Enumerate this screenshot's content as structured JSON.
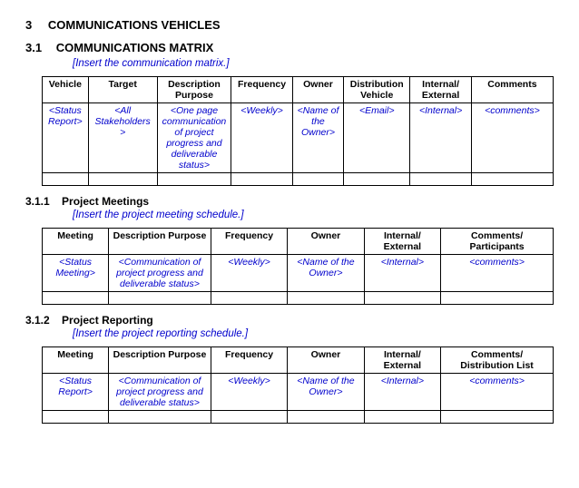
{
  "headings": {
    "h1_num": "3",
    "h1_text": "COMMUNICATIONS VEHICLES",
    "h2_num": "3.1",
    "h2_text": "COMMUNICATIONS MATRIX",
    "h2_instruction": "[Insert the communication matrix.]",
    "h3a_num": "3.1.1",
    "h3a_text": "Project Meetings",
    "h3a_instruction": "[Insert the project meeting schedule.]",
    "h3b_num": "3.1.2",
    "h3b_text": "Project Reporting",
    "h3b_instruction": "[Insert the project reporting schedule.]"
  },
  "table_matrix": {
    "headers": [
      "Vehicle",
      "Target",
      "Description Purpose",
      "Frequency",
      "Owner",
      "Distribution Vehicle",
      "Internal/ External",
      "Comments"
    ],
    "row": [
      "<Status Report>",
      "<All Stakeholders>",
      "<One page communication of project progress and deliverable status>",
      "<Weekly>",
      "<Name of the Owner>",
      "<Email>",
      "<Internal>",
      "<comments>"
    ]
  },
  "table_meetings": {
    "headers": [
      "Meeting",
      "Description Purpose",
      "Frequency",
      "Owner",
      "Internal/ External",
      "Comments/ Participants"
    ],
    "row": [
      "<Status Meeting>",
      "<Communication of project progress and deliverable status>",
      "<Weekly>",
      "<Name of the Owner>",
      "<Internal>",
      "<comments>"
    ]
  },
  "table_reporting": {
    "headers": [
      "Meeting",
      "Description Purpose",
      "Frequency",
      "Owner",
      "Internal/ External",
      "Comments/ Distribution List"
    ],
    "row": [
      "<Status Report>",
      "<Communication of project progress and deliverable status>",
      "<Weekly>",
      "<Name of the Owner>",
      "<Internal>",
      "<comments>"
    ]
  }
}
